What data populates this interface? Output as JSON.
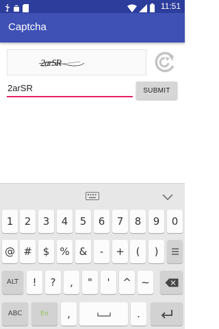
{
  "status_bar": {
    "time": "11:51"
  },
  "app_bar": {
    "title": "Captcha"
  },
  "captcha": {
    "text": "2arSR"
  },
  "form": {
    "input_value": "2arSR",
    "submit_label": "SUBMIT"
  },
  "keyboard": {
    "row1": [
      "1",
      "2",
      "3",
      "4",
      "5",
      "6",
      "7",
      "8",
      "9",
      "0"
    ],
    "row2": [
      "@",
      "#",
      "$",
      "%",
      "&",
      "-",
      "+",
      "(",
      ")"
    ],
    "row3": [
      "ALT",
      "!",
      "?",
      ",",
      "\"",
      "'",
      "…",
      "^",
      "~"
    ],
    "abc": "ABC",
    "lang": "En",
    "comma": ",",
    "period": "."
  }
}
